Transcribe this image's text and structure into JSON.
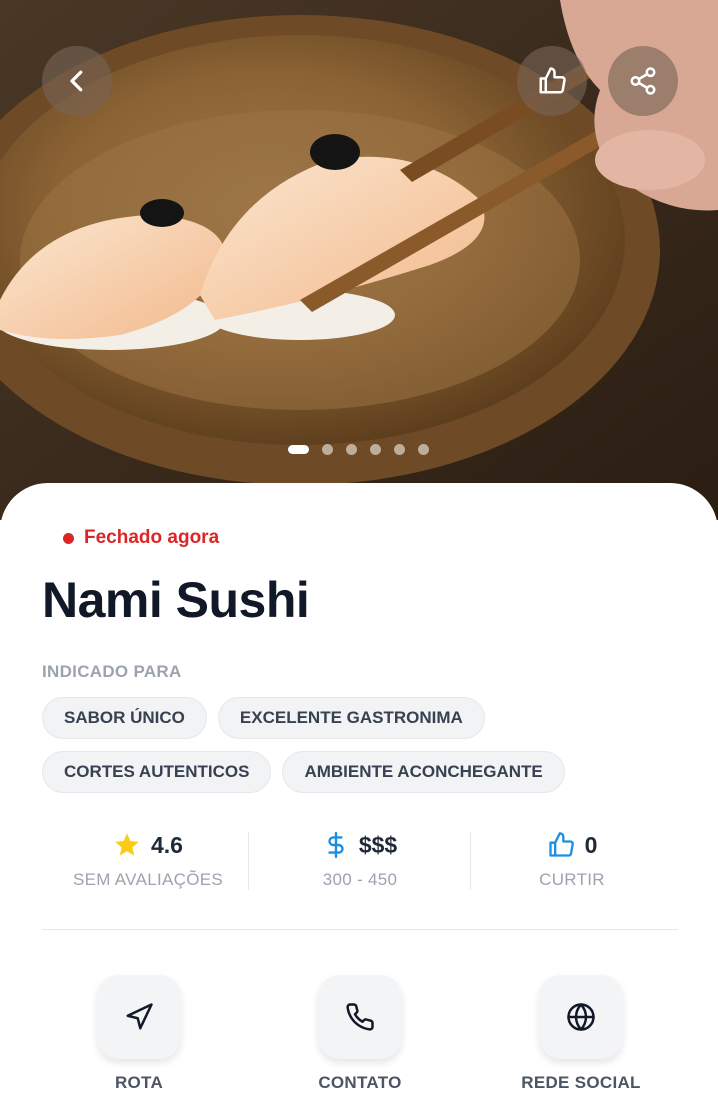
{
  "hero": {
    "image_icon": "sushi-photo",
    "slides_total": 6,
    "active_slide": 1,
    "back_icon": "chevron-left-icon",
    "like_icon": "thumbs-up-icon",
    "share_icon": "share-icon"
  },
  "restaurant": {
    "status": "Fechado agora",
    "status_color": "#dc2626",
    "name": "Nami Sushi"
  },
  "recommended": {
    "label": "INDICADO PARA",
    "tags": [
      "SABOR ÚNICO",
      "EXCELENTE GASTRONIMA",
      "CORTES AUTENTICOS",
      "AMBIENTE ACONCHEGANTE"
    ]
  },
  "stats": {
    "rating": {
      "value": "4.6",
      "sub": "SEM AVALIAÇÕES",
      "icon": "star-icon",
      "icon_color": "#facc15"
    },
    "price": {
      "value": "$$$",
      "sub": "300 - 450",
      "icon": "dollar-icon",
      "icon_color": "#1d8fe1"
    },
    "likes": {
      "value": "0",
      "sub": "CURTIR",
      "icon": "thumbs-up-icon",
      "icon_color": "#1d8fe1"
    }
  },
  "actions": [
    {
      "label": "ROTA",
      "icon": "navigation-arrow-icon"
    },
    {
      "label": "CONTATO",
      "icon": "phone-icon"
    },
    {
      "label": "REDE SOCIAL",
      "icon": "globe-icon"
    }
  ]
}
